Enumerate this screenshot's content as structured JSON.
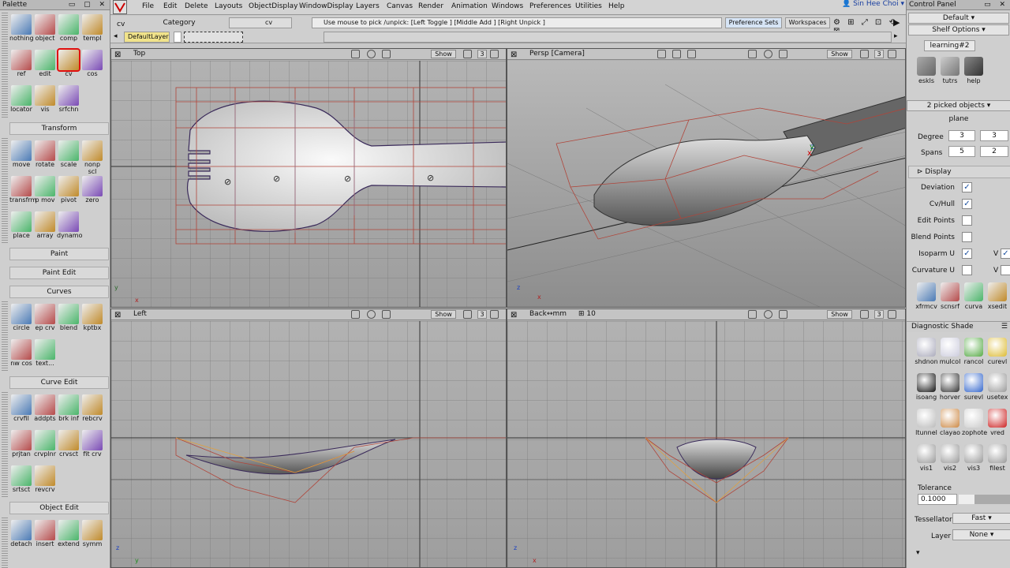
{
  "palette": {
    "title": "Palette",
    "rows1": [
      {
        "tools": [
          {
            "label": "nothing",
            "icon": "nothing-icon"
          },
          {
            "label": "object",
            "icon": "object-pick-icon"
          },
          {
            "label": "comp",
            "icon": "component-pick-icon"
          },
          {
            "label": "templ",
            "icon": "template-icon"
          }
        ]
      },
      {
        "tools": [
          {
            "label": "ref",
            "icon": "reference-icon"
          },
          {
            "label": "edit",
            "icon": "edit-icon"
          },
          {
            "label": "cv",
            "icon": "cv-pick-icon"
          },
          {
            "label": "cos",
            "icon": "cos-pick-icon"
          }
        ]
      },
      {
        "tools": [
          {
            "label": "locator",
            "icon": "locator-icon"
          },
          {
            "label": "vis",
            "icon": "visible-icon"
          },
          {
            "label": "srfchn",
            "icon": "surface-chain-icon"
          }
        ]
      }
    ],
    "sections": {
      "transform": "Transform",
      "paint": "Paint",
      "paint_edit": "Paint Edit",
      "curves": "Curves",
      "curve_edit": "Curve Edit",
      "object_edit": "Object Edit"
    },
    "transform": [
      [
        "move",
        "rotate",
        "scale",
        "nonp scl"
      ],
      [
        "transfrm",
        "p mov",
        "pivot",
        "zero"
      ],
      [
        "place",
        "array",
        "dynamo"
      ]
    ],
    "curves": [
      [
        "circle",
        "ep crv",
        "blend",
        "kptbx"
      ],
      [
        "nw cos",
        "text..."
      ]
    ],
    "curve_edit": [
      [
        "crvfil",
        "addpts",
        "brk inf",
        "rebcrv"
      ],
      [
        "prjtan",
        "crvplnr",
        "crvsct",
        "fit crv"
      ],
      [
        "srtsct",
        "revcrv"
      ]
    ],
    "object_edit": [
      [
        "detach",
        "insert",
        "extend",
        "symm"
      ]
    ]
  },
  "menubar": {
    "items": [
      "File",
      "Edit",
      "Delete",
      "Layouts",
      "ObjectDisplay",
      "WindowDisplay",
      "Layers",
      "Canvas",
      "Render",
      "Animation",
      "Windows",
      "Preferences",
      "Utilities",
      "Help"
    ],
    "user": "Sin Hee Choi"
  },
  "toolbar": {
    "cv_label": "cv",
    "category": "Category",
    "cv_field": "cv",
    "prompt": "Use mouse to pick /unpick: [Left Toggle ] [Middle Add ] [Right Unpick ]",
    "preference_sets": "Preference Sets",
    "workspaces": "Workspaces",
    "layer": "DefaultLayer"
  },
  "viewports": {
    "top": {
      "title": "Top",
      "show": "Show",
      "num": "3"
    },
    "persp": {
      "title": "Persp [Camera]",
      "show": "Show",
      "num": "3"
    },
    "left": {
      "title": "Left",
      "show": "Show",
      "num": "3"
    },
    "back": {
      "title": "Back",
      "units": "↔mm",
      "grid": "10",
      "show": "Show",
      "num": "3"
    }
  },
  "control_panel": {
    "title": "Control Panel",
    "default": "Default",
    "shelf_options": "Shelf Options",
    "shelf_tab": "learning#2",
    "shelf_tools": [
      "eskls",
      "tutrs",
      "help"
    ],
    "picked": "2 picked objects",
    "type": "plane",
    "degree_label": "Degree",
    "degree": [
      "3",
      "3"
    ],
    "spans_label": "Spans",
    "spans": [
      "5",
      "2"
    ],
    "display": "Display",
    "options": [
      {
        "label": "Deviation",
        "checked": true
      },
      {
        "label": "Cv/Hull",
        "checked": true
      },
      {
        "label": "Edit Points",
        "checked": false
      },
      {
        "label": "Blend Points",
        "checked": false
      },
      {
        "label": "Isoparm U",
        "checked": true,
        "v": true
      },
      {
        "label": "Curvature U",
        "checked": false,
        "v": false
      }
    ],
    "v_label": "V",
    "tools2": [
      "xfrmcv",
      "scnsrf",
      "curva",
      "xsedit"
    ],
    "diag_title": "Diagnostic Shade",
    "diag_tools": [
      [
        "shdnon",
        "mulcol",
        "rancol",
        "curevl"
      ],
      [
        "isoang",
        "horver",
        "surevl",
        "usetex"
      ],
      [
        "ltunnel",
        "clayao",
        "zophote",
        "vred"
      ],
      [
        "vis1",
        "vis2",
        "vis3",
        "filest"
      ]
    ],
    "tolerance_label": "Tolerance",
    "tolerance": "0.1000",
    "tessellator_label": "Tessellator",
    "tessellator": "Fast",
    "layer_label": "Layer",
    "layer": "None"
  }
}
